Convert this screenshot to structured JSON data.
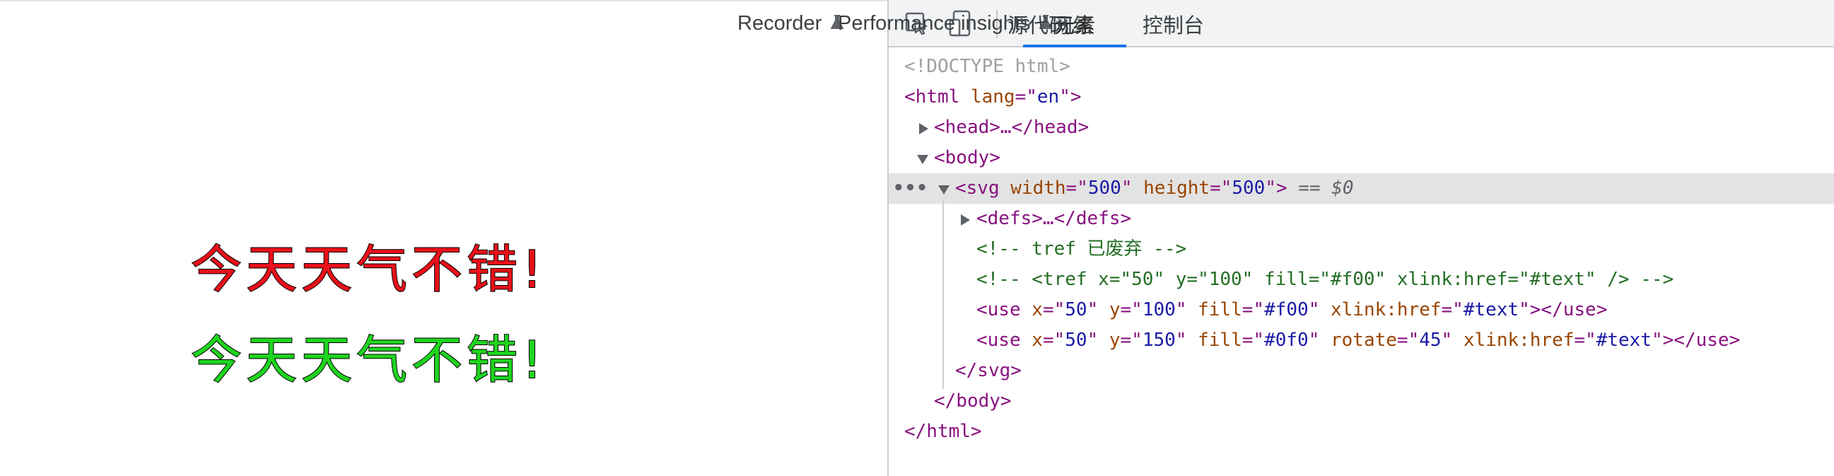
{
  "rendered_page": {
    "line_red": "今天天气不错!",
    "line_green": "今天天气不错!"
  },
  "devtools": {
    "toolbar": {
      "inspect_icon": "select-element-icon",
      "device_icon": "device-toolbar-icon",
      "tabs": [
        {
          "label": "元素",
          "active": true
        },
        {
          "label": "控制台"
        },
        {
          "label": "Recorder",
          "icon": "flask-icon"
        },
        {
          "label": "Performance insights",
          "icon": "flask-icon"
        },
        {
          "label": "源代码"
        },
        {
          "label": "网络"
        }
      ]
    },
    "tree": {
      "doctype": "<!DOCTYPE html>",
      "html_open": "<html",
      "html_attr": " lang",
      "html_eq": "=\"",
      "html_val": "en",
      "html_close": "\">",
      "head": "<head>…</head>",
      "body_open": "<body>",
      "svg_open": "<svg",
      "svg_width_attr": " width",
      "svg_width_val": "500",
      "svg_height_attr": " height",
      "svg_height_val": "500",
      "svg_close": ">",
      "svg_selected_marker": " == ",
      "svg_dollar": "$0",
      "dots": "•••",
      "defs": "<defs>…</defs>",
      "comment1": "<!-- tref 已废弃 -->",
      "comment2": "<!-- <tref x=\"50\" y=\"100\" fill=\"#f00\" xlink:href=\"#text\" /> -->",
      "use1": {
        "open": "<use",
        "x_attr": " x",
        "x_val": "50",
        "y_attr": " y",
        "y_val": "100",
        "fill_attr": " fill",
        "fill_val": "#f00",
        "href_attr": " xlink:href",
        "href_val": "#text",
        "close": "></use>"
      },
      "use2": {
        "open": "<use",
        "x_attr": " x",
        "x_val": "50",
        "y_attr": " y",
        "y_val": "150",
        "fill_attr": " fill",
        "fill_val": "#0f0",
        "rotate_attr": " rotate",
        "rotate_val": "45",
        "href_attr": " xlink:href",
        "href_val": "#text",
        "close": "></use>"
      },
      "svg_end": "</svg>",
      "body_end": "</body>",
      "html_end": "</html>"
    }
  },
  "colors": {
    "red_text": "#e8101a",
    "green_text": "#1fd41f",
    "active_tab_underline": "#1a73e8"
  }
}
